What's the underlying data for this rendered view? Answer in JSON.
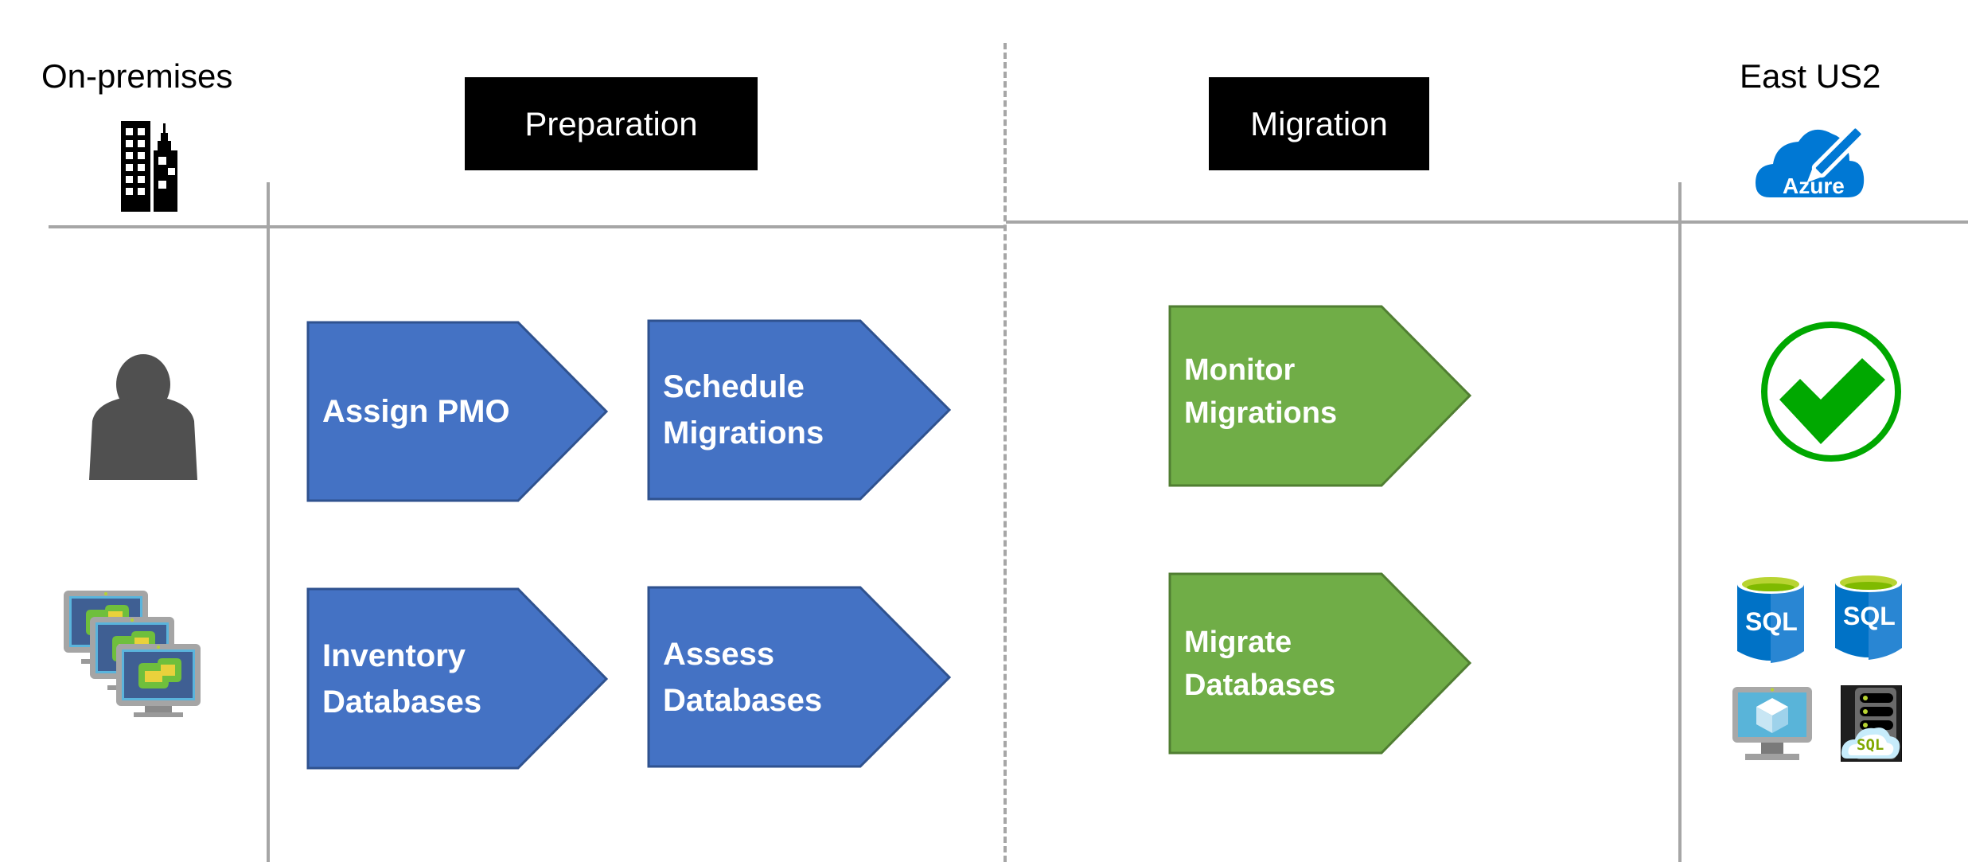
{
  "regions": {
    "source": "On-premises",
    "target": "East US2"
  },
  "phases": [
    {
      "label": "Preparation"
    },
    {
      "label": "Migration"
    }
  ],
  "steps": {
    "preparation": [
      {
        "lines": [
          "Assign PMO"
        ],
        "color": "#4472c4",
        "border": "#2f528f"
      },
      {
        "lines": [
          "Schedule",
          "Migrations"
        ],
        "color": "#4472c4",
        "border": "#2f528f"
      },
      {
        "lines": [
          "Inventory",
          "Databases"
        ],
        "color": "#4472c4",
        "border": "#2f528f"
      },
      {
        "lines": [
          "Assess",
          "Databases"
        ],
        "color": "#4472c4",
        "border": "#2f528f"
      }
    ],
    "migration": [
      {
        "lines": [
          "Monitor",
          "Migrations"
        ],
        "color": "#70ad47",
        "border": "#507e32"
      },
      {
        "lines": [
          "Migrate",
          "Databases"
        ],
        "color": "#70ad47",
        "border": "#507e32"
      }
    ]
  },
  "icons": {
    "source_building": "office-building-icon",
    "source_user": "user-icon",
    "source_vms": "vmware-virtual-machines-icon",
    "target_cloud": "azure-cloud-icon",
    "target_cloud_text": "Azure",
    "target_success": "checkmark-circle-icon",
    "target_sql_1_text": "SQL",
    "target_sql_2_text": "SQL",
    "target_vm": "azure-virtual-machine-icon",
    "target_sql_server_text": "SQL"
  },
  "colors": {
    "preparation": "#4472c4",
    "migration": "#70ad47",
    "success": "#00a800",
    "azure": "#0078d4",
    "divider": "#a6a6a6"
  }
}
